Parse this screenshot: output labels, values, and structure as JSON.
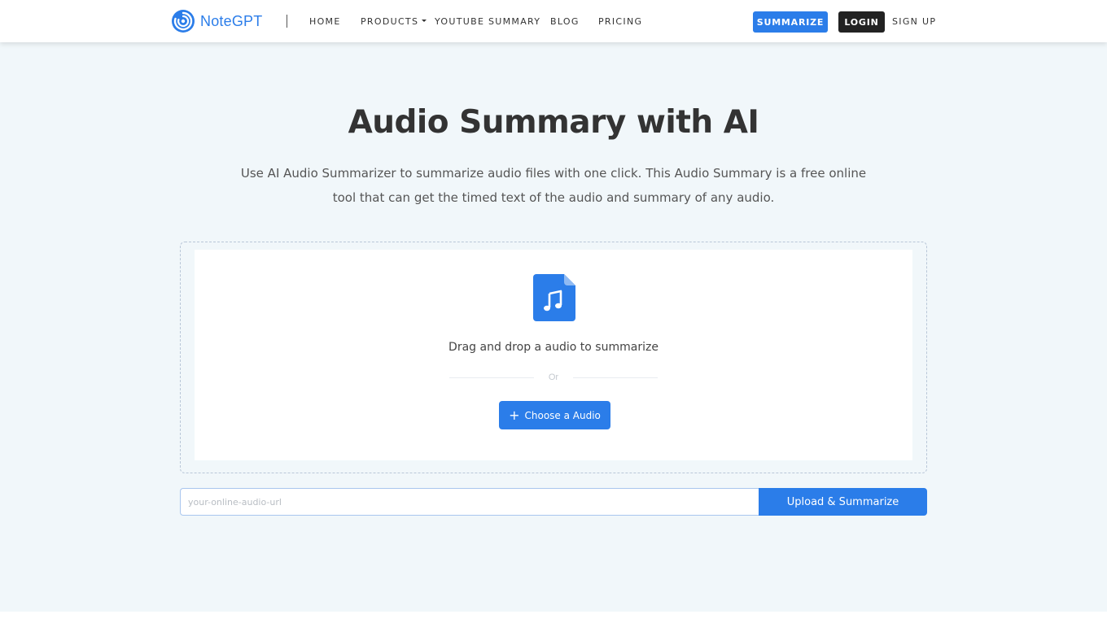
{
  "header": {
    "logo_text": "NoteGPT",
    "nav": {
      "home": "HOME",
      "products": "PRODUCTS",
      "youtube_summary": "YOUTUBE SUMMARY",
      "blog": "BLOG",
      "pricing": "PRICING"
    },
    "summarize_label": "SUMMARIZE",
    "login_label": "LOGIN",
    "signup_label": "SIGN UP"
  },
  "main": {
    "title": "Audio Summary with AI",
    "subtitle": "Use AI Audio Summarizer to summarize audio files with one click. This Audio Summary is a free online tool that can get the timed text of the audio and summary of any audio.",
    "dropzone": {
      "icon": "music-file-icon",
      "prompt": "Drag and drop a audio to summarize",
      "or_text": "Or",
      "choose_label": "Choose a Audio",
      "choose_icon": "plus-icon"
    },
    "url_form": {
      "placeholder": "your-online-audio-url",
      "value": "",
      "submit_label": "Upload & Summarize"
    }
  },
  "colors": {
    "accent": "#2b7de9",
    "dark_button": "#222222",
    "page_background": "#f1f7fa"
  }
}
